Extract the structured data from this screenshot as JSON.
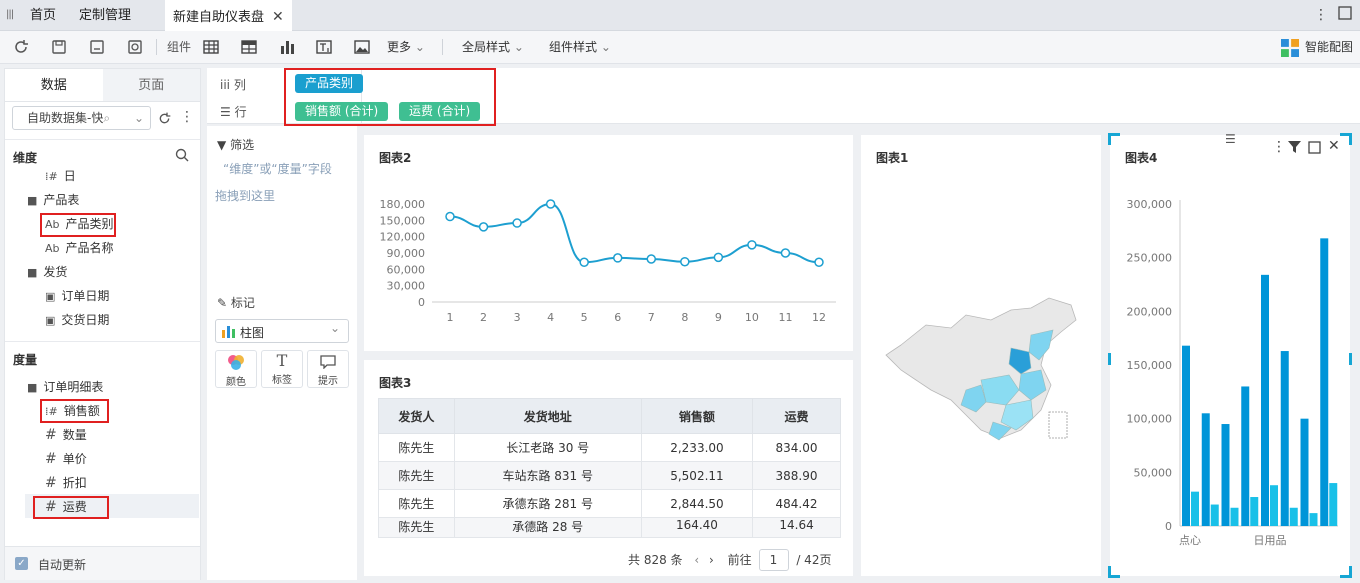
{
  "tabs": {
    "home": "首页",
    "custom": "定制管理",
    "dashboard": "新建自助仪表盘"
  },
  "toolbar": {
    "component_label": "组件",
    "more": "更多",
    "global_style": "全局样式",
    "component_style": "组件样式",
    "smart": "智能配图"
  },
  "left": {
    "tab_data": "数据",
    "tab_page": "页面",
    "dataset": "自助数据集-快",
    "dim_header": "维度",
    "dims": {
      "day": "日",
      "product_table": "产品表",
      "product_category": "产品类别",
      "product_name": "产品名称",
      "ship": "发货",
      "order_date": "订单日期",
      "ship_date": "交货日期"
    },
    "measure_header": "度量",
    "measures": {
      "order_detail": "订单明细表",
      "sales": "销售额",
      "qty": "数量",
      "price": "单价",
      "discount": "折扣",
      "freight": "运费"
    },
    "auto_update": "自动更新"
  },
  "shelves": {
    "column_label": "列",
    "row_label": "行",
    "column_pill": "产品类别",
    "row_pill1": "销售额 (合计)",
    "row_pill2": "运费 (合计)"
  },
  "mid": {
    "filter": "筛选",
    "filter_hint": "“维度”或“度量”字段",
    "filter_hint2": "拖拽到这里",
    "marks": "标记",
    "chart_type": "柱图",
    "color": "颜色",
    "label": "标签",
    "tooltip": "提示"
  },
  "chart2": {
    "title": "图表2"
  },
  "chart1": {
    "title": "图表1"
  },
  "chart4": {
    "title": "图表4",
    "xlabels": [
      "点心",
      "日用品"
    ]
  },
  "chart3": {
    "title": "图表3",
    "headers": [
      "发货人",
      "发货地址",
      "销售额",
      "运费"
    ],
    "rows": [
      [
        "陈先生",
        "长江老路 30 号",
        "2,233.00",
        "834.00"
      ],
      [
        "陈先生",
        "车站东路 831 号",
        "5,502.11",
        "388.90"
      ],
      [
        "陈先生",
        "承德东路 281 号",
        "2,844.50",
        "484.42"
      ],
      [
        "陈先生",
        "承德路 28 号",
        "164.40",
        "14.64"
      ]
    ],
    "total": "共 828 条",
    "goto": "前往",
    "page": "1",
    "pages": "/ 42页"
  },
  "colors": {
    "accent": "#0aa0d0",
    "pill_green": "#3fbf92",
    "pill_blue": "#1a9fcf",
    "bar_dark": "#0095d8",
    "bar_light": "#19c0e8",
    "line": "#1d9fd0",
    "red_box": "#e02020"
  },
  "chart_data": [
    {
      "type": "line",
      "x": [
        1,
        2,
        3,
        4,
        5,
        6,
        7,
        8,
        9,
        10,
        11,
        12
      ],
      "values": [
        157000,
        138000,
        145000,
        180000,
        73000,
        81000,
        79000,
        74000,
        82000,
        105000,
        90000,
        73000
      ],
      "yticks": [
        "180,000",
        "150,000",
        "120,000",
        "90,000",
        "60,000",
        "30,000",
        "0"
      ],
      "ylim": [
        0,
        180000
      ]
    },
    {
      "type": "bar",
      "series": [
        {
          "values": [
            168000,
            105000,
            95000,
            130000,
            234000,
            163000,
            100000,
            268000
          ]
        },
        {
          "values": [
            32000,
            20000,
            17000,
            27000,
            38000,
            17000,
            12000,
            40000
          ]
        }
      ],
      "yticks": [
        "300,000",
        "250,000",
        "200,000",
        "150,000",
        "100,000",
        "50,000",
        "0"
      ],
      "ylim": [
        0,
        300000
      ]
    }
  ]
}
